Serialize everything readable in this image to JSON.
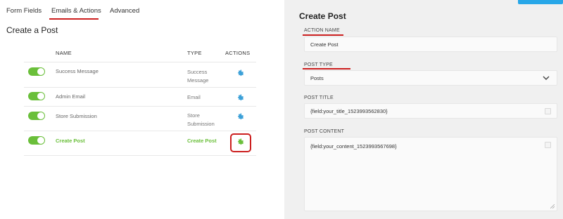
{
  "tabs": [
    {
      "label": "Form Fields"
    },
    {
      "label": "Emails & Actions",
      "active": true
    },
    {
      "label": "Advanced"
    }
  ],
  "page_title": "Create a Post",
  "table": {
    "headers": {
      "name": "NAME",
      "type": "TYPE",
      "actions": "ACTIONS"
    },
    "rows": [
      {
        "name": "Success Message",
        "type": "Success Message",
        "enabled": true
      },
      {
        "name": "Admin Email",
        "type": "Email",
        "enabled": true
      },
      {
        "name": "Store Submission",
        "type": "Store Submission",
        "enabled": true
      },
      {
        "name": "Create Post",
        "type": "Create Post",
        "enabled": true,
        "selected": true
      }
    ]
  },
  "panel": {
    "title": "Create Post",
    "fields": {
      "action_name": {
        "label": "ACTION NAME",
        "value": "Create Post"
      },
      "post_type": {
        "label": "POST TYPE",
        "value": "Posts"
      },
      "post_title": {
        "label": "POST TITLE",
        "value": "{field:your_title_1523993562830}"
      },
      "post_content": {
        "label": "POST CONTENT",
        "value": "{field:your_content_1523993567698}"
      }
    }
  },
  "colors": {
    "accent_green": "#6abf3a",
    "gear_blue": "#3ba0d8",
    "annotation_red": "#cc1f1f",
    "save_button_blue": "#28a7e8"
  },
  "icons": {
    "gear": "gear-icon",
    "chevron": "chevron-down-icon"
  }
}
